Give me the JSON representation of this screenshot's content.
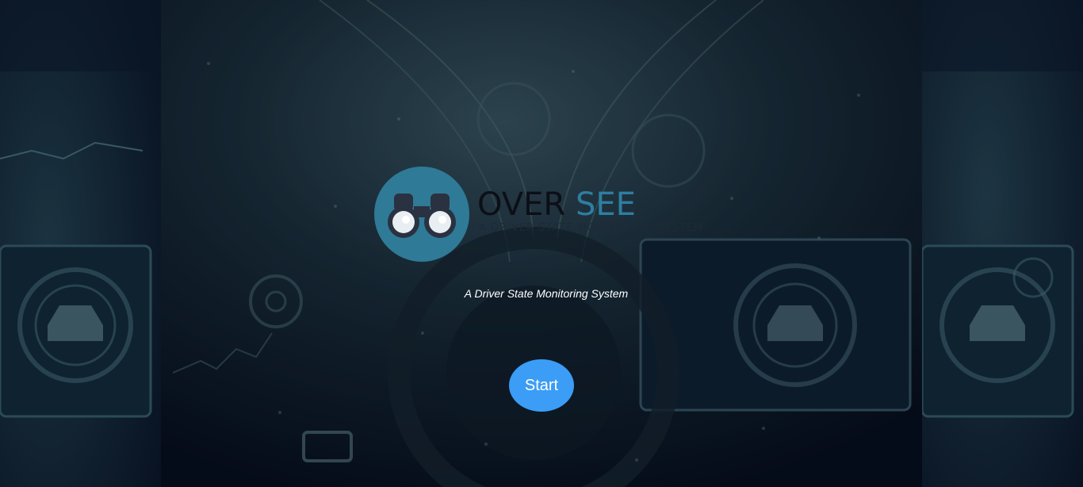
{
  "brand": {
    "word_over": "OVER",
    "word_see": "SEE",
    "tagline": "A DRIVER STATE MONITORING SYSTEM",
    "logo_icon": "binoculars-icon",
    "circle_color": "#2f7a97",
    "see_color": "#2e7ea2"
  },
  "hero": {
    "subtitle": "A Driver State Monitoring System"
  },
  "actions": {
    "start_label": "Start",
    "start_color": "#3b9df5"
  }
}
